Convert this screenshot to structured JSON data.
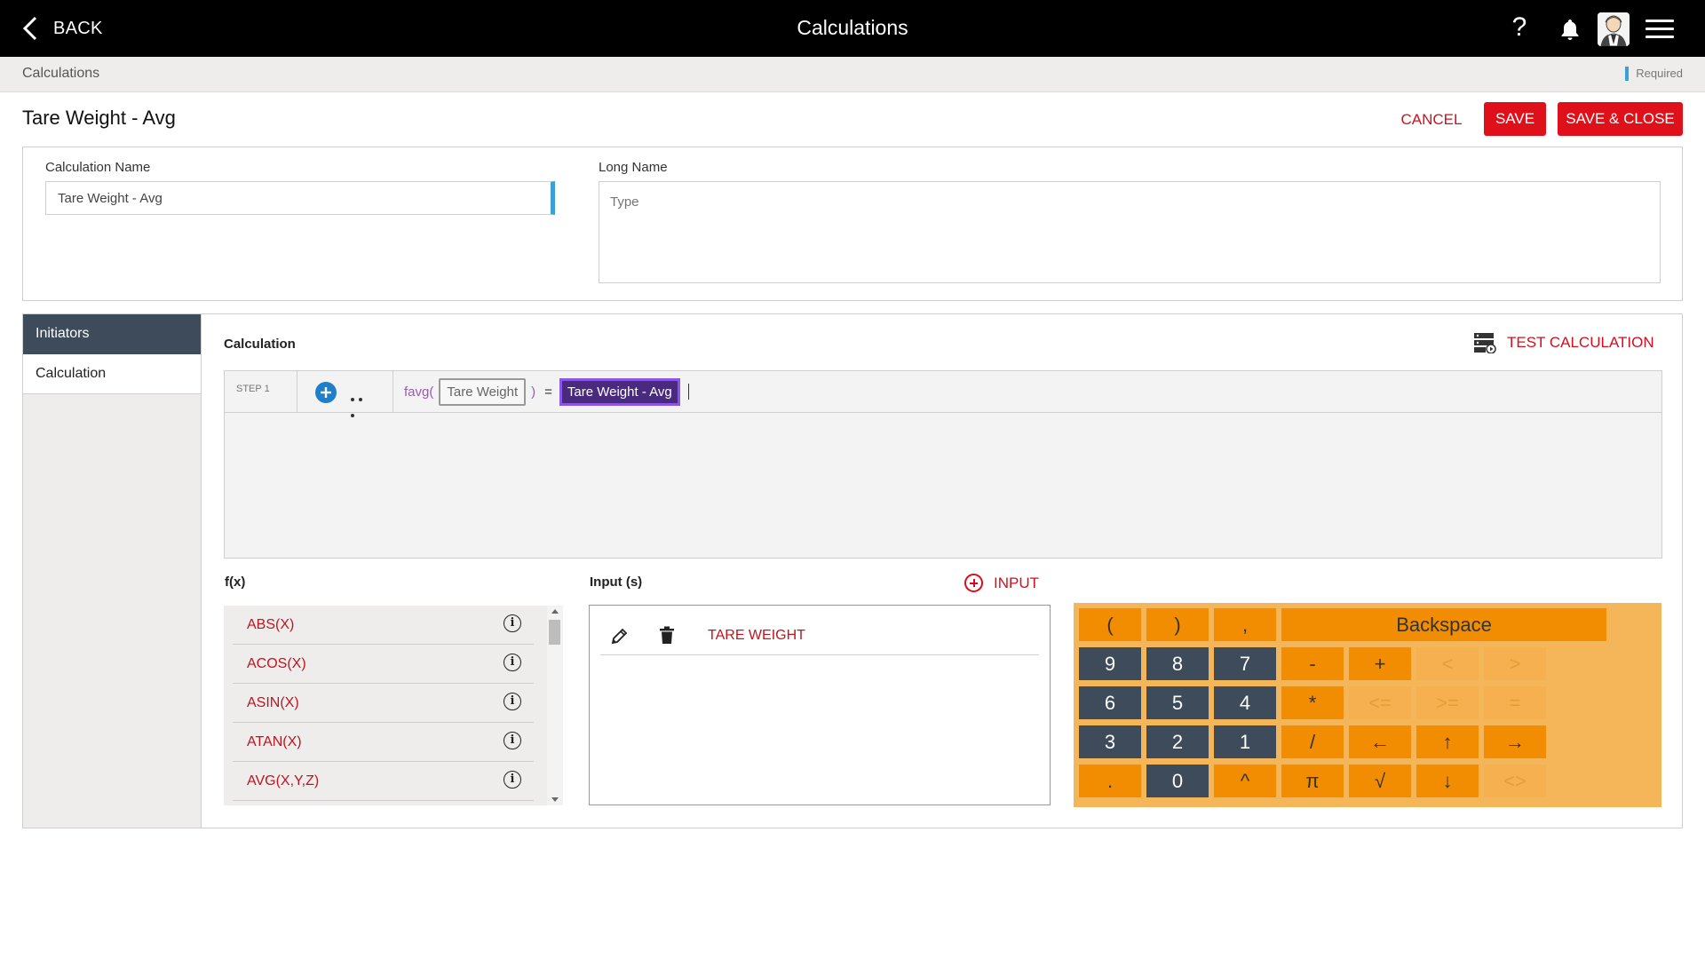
{
  "topbar": {
    "back_label": "BACK",
    "title": "Calculations",
    "help_glyph": "?"
  },
  "breadcrumb": {
    "current": "Calculations",
    "required_label": "Required"
  },
  "header": {
    "page_title": "Tare Weight - Avg",
    "cancel_label": "CANCEL",
    "save_label": "SAVE",
    "save_close_label": "SAVE & CLOSE"
  },
  "form": {
    "calc_name_label": "Calculation Name",
    "calc_name_value": "Tare Weight - Avg",
    "long_name_label": "Long Name",
    "long_name_placeholder": "Type"
  },
  "leftnav": {
    "items": [
      {
        "label": "Initiators",
        "active": true
      },
      {
        "label": "Calculation",
        "active": false
      }
    ]
  },
  "calculation": {
    "section_title": "Calculation",
    "test_label": "TEST CALCULATION",
    "step_label": "STEP 1",
    "formula": {
      "func": "favg(",
      "token": "Tare Weight",
      "close_paren": ")",
      "equals": "=",
      "result": "Tare Weight - Avg"
    }
  },
  "fx": {
    "title": "f(x)",
    "items": [
      "ABS(X)",
      "ACOS(X)",
      "ASIN(X)",
      "ATAN(X)",
      "AVG(X,Y,Z)"
    ],
    "info_glyph": "i"
  },
  "inputs": {
    "title": "Input (s)",
    "add_label": "INPUT",
    "rows": [
      {
        "name": "TARE WEIGHT"
      }
    ]
  },
  "keypad": {
    "rows": [
      [
        "(",
        ")",
        ",",
        "Backspace"
      ],
      [
        "9",
        "8",
        "7",
        "-",
        "+",
        "<",
        ">"
      ],
      [
        "6",
        "5",
        "4",
        "*",
        "<=",
        ">=",
        "="
      ],
      [
        "3",
        "2",
        "1",
        "/",
        "←",
        "↑",
        "→"
      ],
      [
        ".",
        "0",
        "^",
        "π",
        "√",
        "↓",
        "<>"
      ]
    ]
  },
  "colors": {
    "accent_red": "#e0101b",
    "nav_dark": "#3e4b5b",
    "keypad_orange": "#f28c00",
    "required_blue": "#3aa0d8",
    "formula_purple": "#4a2a7f"
  }
}
